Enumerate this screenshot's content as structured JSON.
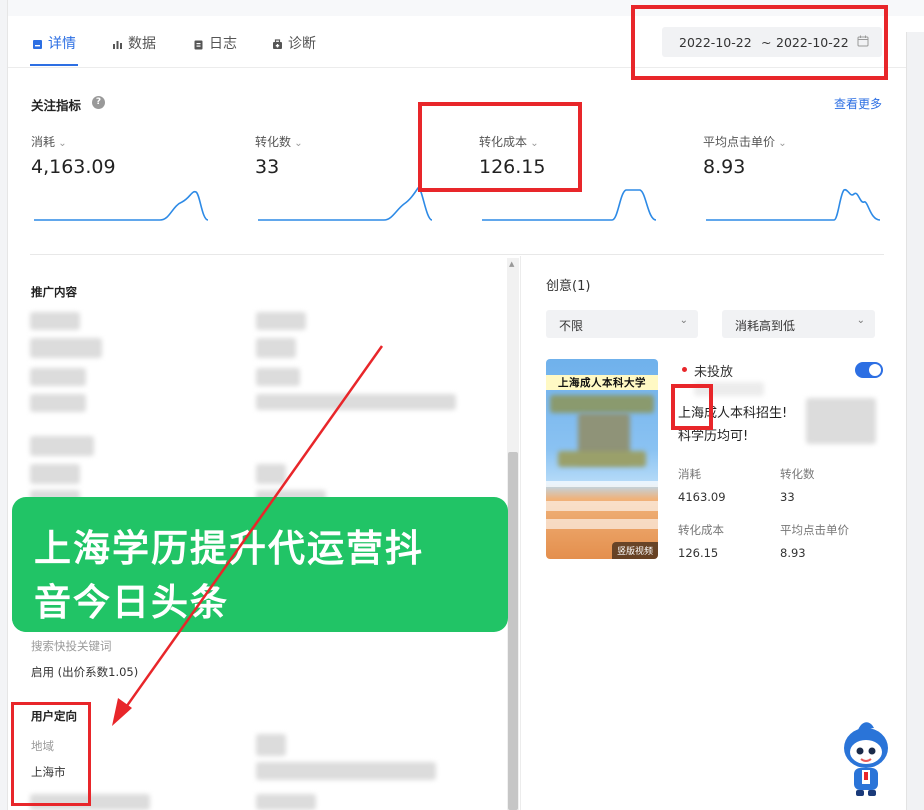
{
  "tabs": [
    {
      "label": "详情",
      "icon": "detail-icon",
      "active": true
    },
    {
      "label": "数据",
      "icon": "bar-chart-icon",
      "active": false
    },
    {
      "label": "日志",
      "icon": "log-icon",
      "active": false
    },
    {
      "label": "诊断",
      "icon": "diagnose-icon",
      "active": false
    }
  ],
  "date_range": {
    "start": "2022-10-22",
    "separator": "~",
    "end": "2022-10-22",
    "icon": "calendar-icon"
  },
  "focus": {
    "title": "关注指标",
    "see_more": "查看更多"
  },
  "metrics": [
    {
      "label": "消耗",
      "value": "4,163.09"
    },
    {
      "label": "转化数",
      "value": "33"
    },
    {
      "label": "转化成本",
      "value": "126.15"
    },
    {
      "label": "平均点击单价",
      "value": "8.93"
    }
  ],
  "left": {
    "promo_content": "推广内容",
    "sections": [
      {
        "title": "搜索快投关键词",
        "value": "启用 (出价系数1.05)"
      }
    ],
    "targeting": {
      "title": "用户定向",
      "region_label": "地域",
      "region_value": "上海市"
    }
  },
  "creative": {
    "title": "创意(1)",
    "filter1": "不限",
    "filter2": "消耗高到低",
    "thumb_title": "上海成人本科大学",
    "thumb_tag": "竖版视频",
    "status": "未投放",
    "ad_line1": "上海成人本科招生!",
    "ad_line2": "科学历均可!",
    "stats": [
      {
        "label": "消耗",
        "value": "4163.09"
      },
      {
        "label": "转化数",
        "value": "33"
      },
      {
        "label": "转化成本",
        "value": "126.15"
      },
      {
        "label": "平均点击单价",
        "value": "8.93"
      }
    ]
  },
  "banner": {
    "line1": "上海学历提升代运营抖",
    "line2": "音今日头条"
  },
  "colors": {
    "accent": "#2d6fe3",
    "annotation": "#e8262a",
    "banner": "#21c466"
  }
}
